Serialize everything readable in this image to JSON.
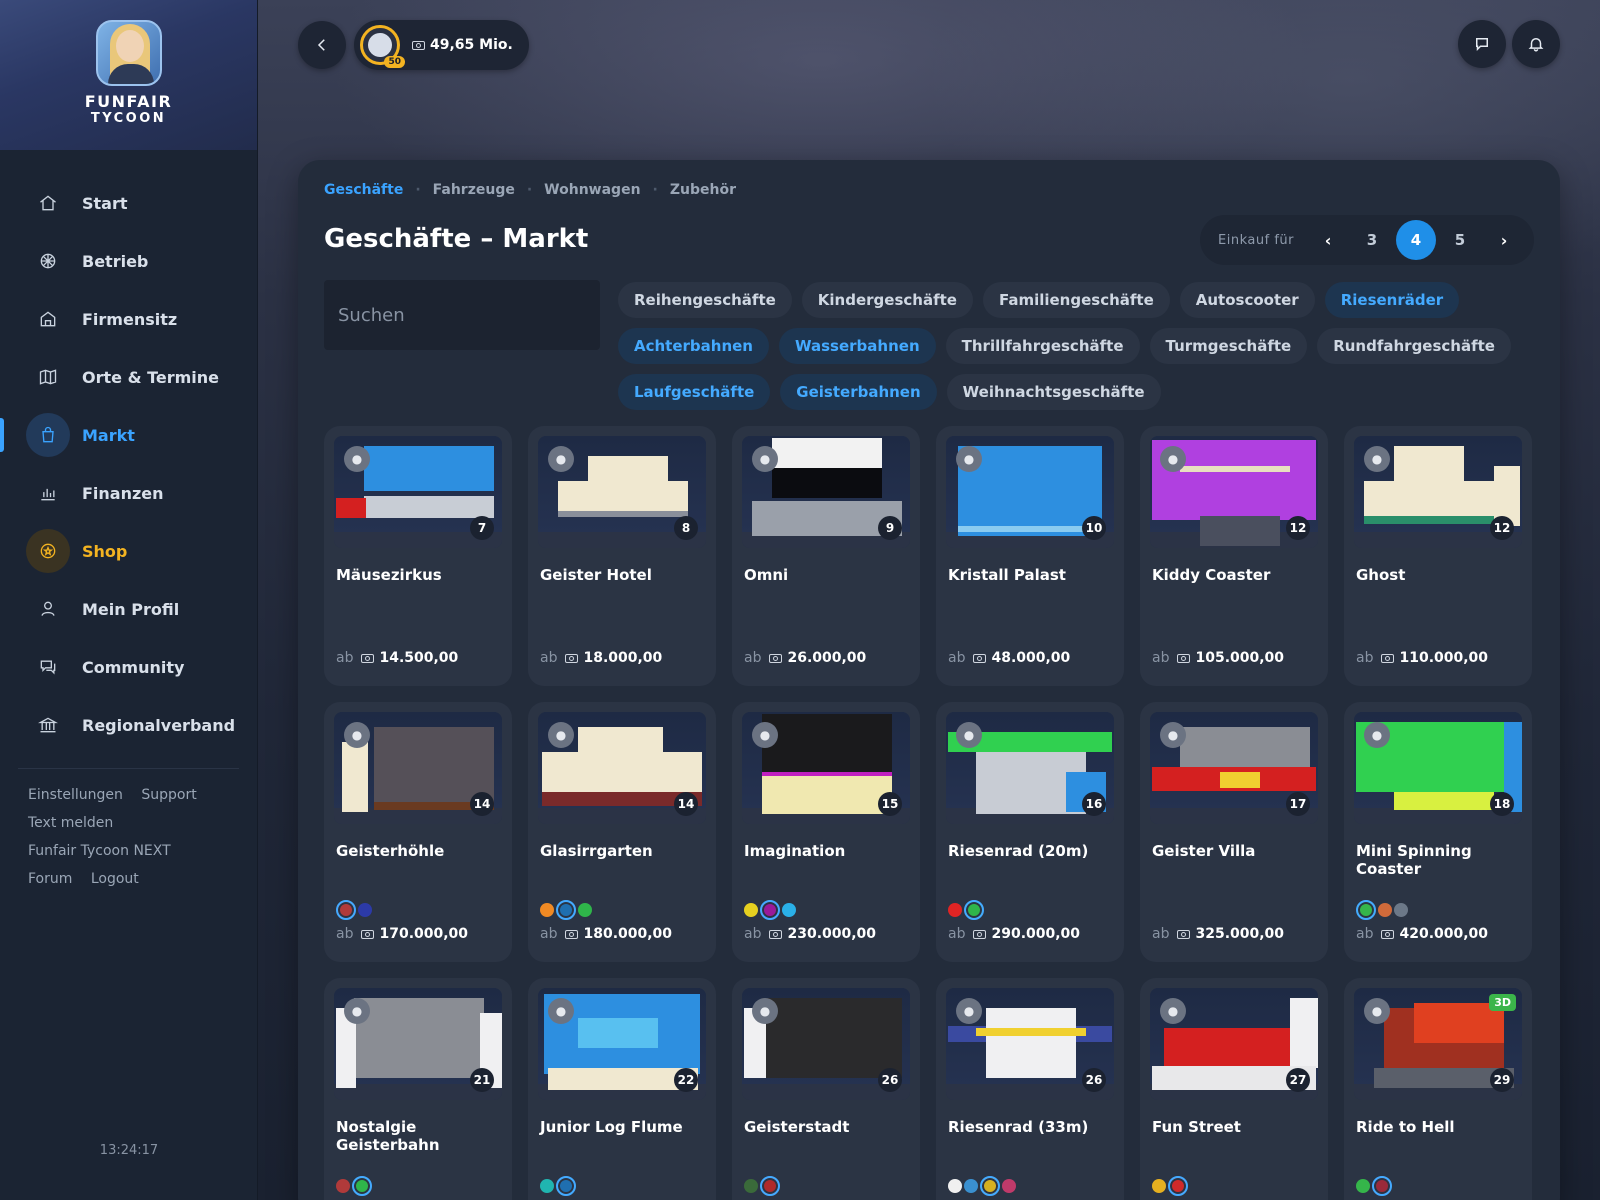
{
  "app": {
    "title_line1": "FUNFAIR",
    "title_line2": "TYCOON"
  },
  "sidebar": {
    "items": [
      {
        "label": "Start",
        "icon": "home-icon"
      },
      {
        "label": "Betrieb",
        "icon": "ferris-wheel-icon"
      },
      {
        "label": "Firmensitz",
        "icon": "building-icon"
      },
      {
        "label": "Orte & Termine",
        "icon": "map-icon"
      },
      {
        "label": "Markt",
        "icon": "shopping-bag-icon"
      },
      {
        "label": "Finanzen",
        "icon": "bar-chart-icon"
      },
      {
        "label": "Shop",
        "icon": "coin-star-icon"
      },
      {
        "label": "Mein Profil",
        "icon": "user-icon"
      },
      {
        "label": "Community",
        "icon": "chat-icon"
      },
      {
        "label": "Regionalverband",
        "icon": "institution-icon"
      }
    ],
    "links": [
      "Einstellungen",
      "Support",
      "Text melden",
      "Funfair Tycoon NEXT",
      "Forum",
      "Logout"
    ],
    "clock": "13:24:17"
  },
  "topbar": {
    "money": "49,65 Mio.",
    "level": "50"
  },
  "breadcrumbs": [
    "Geschäfte",
    "Fahrzeuge",
    "Wohnwagen",
    "Zubehör"
  ],
  "page_title": "Geschäfte – Markt",
  "pager": {
    "label": "Einkauf für",
    "pages": [
      "3",
      "4",
      "5"
    ],
    "prev": "‹",
    "next": "›"
  },
  "search": {
    "placeholder": "Suchen"
  },
  "filters": [
    {
      "label": "Reihengeschäfte",
      "on": false
    },
    {
      "label": "Kindergeschäfte",
      "on": false
    },
    {
      "label": "Familiengeschäfte",
      "on": false
    },
    {
      "label": "Autoscooter",
      "on": false
    },
    {
      "label": "Riesenräder",
      "on": true
    },
    {
      "label": "Achterbahnen",
      "on": true
    },
    {
      "label": "Wasserbahnen",
      "on": true
    },
    {
      "label": "Thrillfahrgeschäfte",
      "on": false
    },
    {
      "label": "Turmgeschäfte",
      "on": false
    },
    {
      "label": "Rundfahrgeschäfte",
      "on": false
    },
    {
      "label": "Laufgeschäfte",
      "on": true
    },
    {
      "label": "Geisterbahnen",
      "on": true
    },
    {
      "label": "Weihnachtsgeschäfte",
      "on": false
    }
  ],
  "price_prefix": "ab",
  "cards": [
    {
      "name": "Mäusezirkus",
      "level": "7",
      "price": "14.500,00",
      "colors": [],
      "badge": "mouse-icon",
      "badge3d": ""
    },
    {
      "name": "Geister Hotel",
      "level": "8",
      "price": "18.000,00",
      "colors": [],
      "badge": "ghost-icon",
      "badge3d": ""
    },
    {
      "name": "Omni",
      "level": "9",
      "price": "26.000,00",
      "colors": [],
      "badge": "eye-icon",
      "badge3d": ""
    },
    {
      "name": "Kristall Palast",
      "level": "10",
      "price": "48.000,00",
      "colors": [],
      "badge": "eye-icon",
      "badge3d": ""
    },
    {
      "name": "Kiddy Coaster",
      "level": "12",
      "price": "105.000,00",
      "colors": [],
      "badge": "coaster-icon",
      "badge3d": ""
    },
    {
      "name": "Ghost",
      "level": "12",
      "price": "110.000,00",
      "colors": [],
      "badge": "ghost-icon",
      "badge3d": ""
    },
    {
      "name": "Geisterhöhle",
      "level": "14",
      "price": "170.000,00",
      "colors": [
        "#b03a3a",
        "#2c3aa8"
      ],
      "selected": 0,
      "badge": "ghost-icon",
      "badge3d": ""
    },
    {
      "name": "Glasirrgarten",
      "level": "14",
      "price": "180.000,00",
      "colors": [
        "#f08a24",
        "#1f6fb0",
        "#2fb54a"
      ],
      "selected": 1,
      "badge": "eye-icon",
      "badge3d": ""
    },
    {
      "name": "Imagination",
      "level": "15",
      "price": "230.000,00",
      "colors": [
        "#e6d020",
        "#9a1a9a",
        "#2ab0e8"
      ],
      "selected": 1,
      "badge": "glasses-icon",
      "badge3d": ""
    },
    {
      "name": "Riesenrad (20m)",
      "level": "16",
      "price": "290.000,00",
      "colors": [
        "#e02424",
        "#2fb54a"
      ],
      "selected": 1,
      "badge": "ferris-wheel-icon",
      "badge3d": ""
    },
    {
      "name": "Geister Villa",
      "level": "17",
      "price": "325.000,00",
      "colors": [],
      "badge": "ghost-icon",
      "badge3d": ""
    },
    {
      "name": "Mini Spinning Coaster",
      "level": "18",
      "price": "420.000,00",
      "colors": [
        "#35b54a",
        "#d06a3a",
        "#6c7888"
      ],
      "selected": 0,
      "badge": "coaster-icon",
      "badge3d": ""
    },
    {
      "name": "Nostalgie Geisterbahn",
      "level": "21",
      "price": "",
      "colors": [
        "#b03a3a",
        "#2fb54a"
      ],
      "selected": 1,
      "badge": "ghost-icon",
      "badge3d": ""
    },
    {
      "name": "Junior Log Flume",
      "level": "22",
      "price": "",
      "colors": [
        "#20b5b0",
        "#1f6fb0"
      ],
      "selected": 1,
      "badge": "log-icon",
      "badge3d": ""
    },
    {
      "name": "Geisterstadt",
      "level": "26",
      "price": "",
      "colors": [
        "#3a6a3a",
        "#b02a2a"
      ],
      "selected": 1,
      "badge": "ghost-icon",
      "badge3d": ""
    },
    {
      "name": "Riesenrad (33m)",
      "level": "26",
      "price": "",
      "colors": [
        "#f0f0f0",
        "#3a90d0",
        "#d6b020",
        "#c03a6a"
      ],
      "selected": 2,
      "badge": "ferris-wheel-icon",
      "badge3d": ""
    },
    {
      "name": "Fun Street",
      "level": "27",
      "price": "",
      "colors": [
        "#e6b020",
        "#d02a2a"
      ],
      "selected": 1,
      "badge": "slide-icon",
      "badge3d": ""
    },
    {
      "name": "Ride to Hell",
      "level": "29",
      "price": "",
      "colors": [
        "#35b54a",
        "#9a2a3a"
      ],
      "selected": 1,
      "badge": "devil-icon",
      "badge3d": "3D"
    }
  ]
}
